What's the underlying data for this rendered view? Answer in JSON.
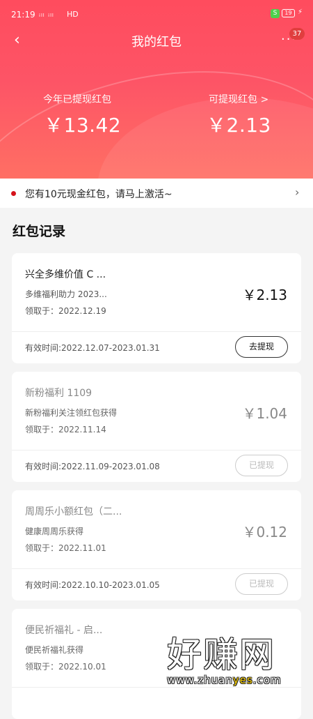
{
  "status_bar": {
    "time": "21:19",
    "signal_text": "ᵢₗₗ ᵢₗₗ",
    "network": "HD",
    "shield_label": "S",
    "battery": "19"
  },
  "header": {
    "title": "我的红包",
    "more_label": "···",
    "badge_count": "37"
  },
  "summary": {
    "withdrawn_label": "今年已提现红包",
    "withdrawn_value": "￥13.42",
    "available_label": "可提现红包 >",
    "available_value": "￥2.13"
  },
  "notice": {
    "text": "您有10元现金红包，请马上激活~",
    "accent_color": "#d5131b"
  },
  "records": {
    "title": "红包记录",
    "items": [
      {
        "name": "兴全多维价值 C ...",
        "desc": "多维福利助力 2023...",
        "date": "领取于：2022.12.19",
        "amount": "￥2.13",
        "validity": "有效时间:2022.12.07-2023.01.31",
        "action": "去提现",
        "status": "available"
      },
      {
        "name": "新粉福利 1109",
        "desc": "新粉福利关注领红包获得",
        "date": "领取于：2022.11.14",
        "amount": "￥1.04",
        "validity": "有效时间:2022.11.09-2023.01.08",
        "action": "已提现",
        "status": "withdrawn"
      },
      {
        "name": "周周乐小额红包（二...",
        "desc": "健康周周乐获得",
        "date": "领取于：2022.11.01",
        "amount": "￥0.12",
        "validity": "有效时间:2022.10.10-2023.01.05",
        "action": "已提现",
        "status": "withdrawn"
      },
      {
        "name": "便民祈福礼 - 启...",
        "desc": "便民祈福礼获得",
        "date": "领取于：2022.10.01",
        "amount": "",
        "validity": "",
        "action": "",
        "status": "withdrawn"
      }
    ]
  },
  "watermark": {
    "title": "好赚网",
    "url_prefix": "www.zhuan",
    "url_highlight": "yes",
    "url_suffix": ".com"
  },
  "colors": {
    "hero_top": "#ff4c5e",
    "hero_bottom": "#ff6f64",
    "page_bg": "#f4f4f4"
  }
}
